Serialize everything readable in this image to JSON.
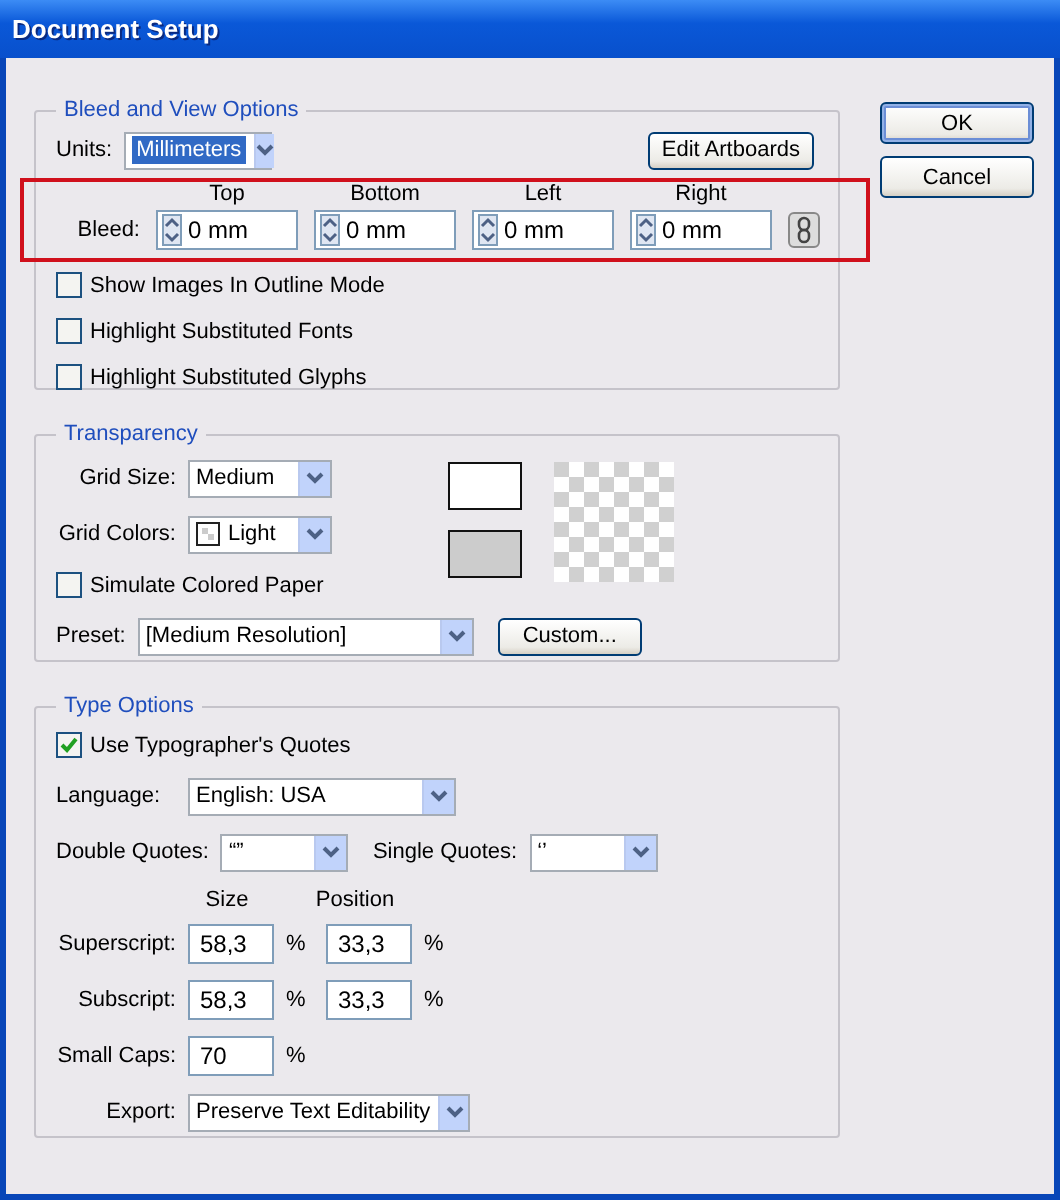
{
  "window": {
    "title": "Document Setup"
  },
  "buttons": [
    {
      "label": "OK",
      "default": true
    },
    {
      "label": "Cancel",
      "default": false
    }
  ],
  "bleed_view": {
    "title": "Bleed and View Options",
    "units": {
      "label": "Units:",
      "value": "Millimeters"
    },
    "edit_artboards": "Edit Artboards",
    "bleed": {
      "label": "Bleed:",
      "fields": [
        {
          "header": "Top",
          "value": "0 mm"
        },
        {
          "header": "Bottom",
          "value": "0 mm"
        },
        {
          "header": "Left",
          "value": "0 mm"
        },
        {
          "header": "Right",
          "value": "0 mm"
        }
      ]
    },
    "checkboxes": [
      {
        "label": "Show Images In Outline Mode",
        "checked": false
      },
      {
        "label": "Highlight Substituted Fonts",
        "checked": false
      },
      {
        "label": "Highlight Substituted Glyphs",
        "checked": false
      }
    ]
  },
  "transparency": {
    "title": "Transparency",
    "grid_size": {
      "label": "Grid Size:",
      "value": "Medium"
    },
    "grid_colors": {
      "label": "Grid Colors:",
      "value": "Light"
    },
    "simulate": {
      "label": "Simulate Colored Paper",
      "checked": false
    },
    "preset": {
      "label": "Preset:",
      "value": "[Medium Resolution]"
    },
    "custom_button": "Custom..."
  },
  "type_options": {
    "title": "Type Options",
    "typographers": {
      "label": "Use Typographer's Quotes",
      "checked": true
    },
    "language": {
      "label": "Language:",
      "value": "English: USA"
    },
    "double_quotes": {
      "label": "Double Quotes:",
      "value": "“”"
    },
    "single_quotes": {
      "label": "Single Quotes:",
      "value": "‘’"
    },
    "headers": [
      "Size",
      "Position"
    ],
    "rows": [
      {
        "label": "Superscript:",
        "fields": [
          {
            "value": "58,3",
            "unit": "%"
          },
          {
            "value": "33,3",
            "unit": "%"
          }
        ]
      },
      {
        "label": "Subscript:",
        "fields": [
          {
            "value": "58,3",
            "unit": "%"
          },
          {
            "value": "33,3",
            "unit": "%"
          }
        ]
      },
      {
        "label": "Small Caps:",
        "fields": [
          {
            "value": "70",
            "unit": "%"
          }
        ]
      }
    ],
    "export": {
      "label": "Export:",
      "value": "Preserve Text Editability"
    }
  }
}
